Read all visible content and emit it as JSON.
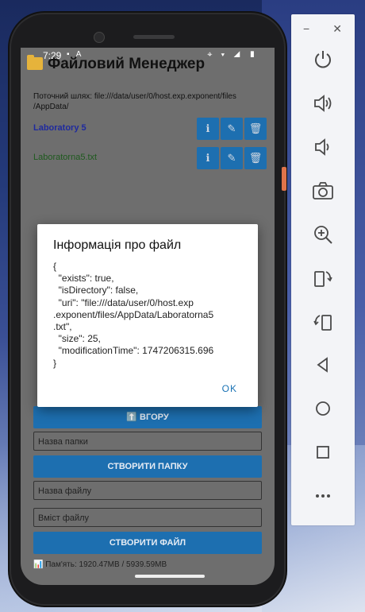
{
  "status": {
    "time": "7:29",
    "left_icons": "▪ A",
    "right_icons": "⌖ ▾ ◢ ▮"
  },
  "app": {
    "title": "Файловий Менеджер",
    "path": "Поточний шлях: file:///data/user/0/host.exp.exponent/files /AppData/"
  },
  "files": [
    {
      "name": "Laboratory 5"
    },
    {
      "name": "Laboratorna5.txt"
    }
  ],
  "actions": {
    "info": "ℹ",
    "edit": "✎",
    "delete": "🗑"
  },
  "buttons": {
    "up": "⬆️ ВГОРУ",
    "create_folder": "СТВОРИТИ ПАПКУ",
    "create_file": "СТВОРИТИ ФАЙЛ"
  },
  "inputs": {
    "folder_name_placeholder": "Назва папки",
    "file_name_placeholder": "Назва файлу",
    "file_content_placeholder": "Вміст файлу"
  },
  "memory": "📊 Пам'ять: 1920.47MB / 5939.59MB",
  "dialog": {
    "title": "Інформація про файл",
    "body": "{\n  \"exists\": true,\n  \"isDirectory\": false,\n  \"uri\": \"file:///data/user/0/host.exp\n.exponent/files/AppData/Laboratorna5\n.txt\",\n  \"size\": 25,\n  \"modificationTime\": 1747206315.696\n}",
    "ok": "OK"
  },
  "toolbar": {
    "minimize": "−",
    "close": "✕",
    "icons": [
      "power-icon",
      "volume-up-icon",
      "volume-down-icon",
      "camera-icon",
      "zoom-icon",
      "rotate-left-icon",
      "rotate-right-icon",
      "back-icon",
      "home-icon",
      "overview-icon",
      "more-icon"
    ]
  }
}
